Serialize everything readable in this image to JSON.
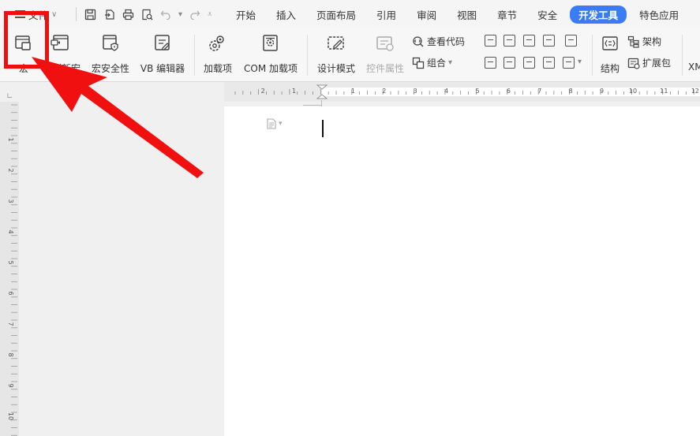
{
  "menu": {
    "file_label": "文件",
    "tabs": [
      "开始",
      "插入",
      "页面布局",
      "引用",
      "审阅",
      "视图",
      "章节",
      "安全",
      "开发工具",
      "特色应用"
    ],
    "active_tab": "开发工具"
  },
  "ribbon": {
    "macro": "宏",
    "record_macro": "录制新宏",
    "macro_security": "宏安全性",
    "vb_editor": "VB 编辑器",
    "addins": "加载项",
    "com_addins": "COM 加载项",
    "design_mode": "设计模式",
    "control_properties": "控件属性",
    "view_code": "查看代码",
    "group": "组合",
    "structure": "结构",
    "schema": "架构",
    "expansion_pack": "扩展包",
    "xml_partial": "XM"
  },
  "ruler": {
    "top_numbers": [
      "2",
      "1",
      "1",
      "2",
      "3",
      "4",
      "5",
      "6",
      "7",
      "8",
      "9",
      "10",
      "11",
      "12"
    ],
    "left_numbers": [
      "1",
      "2",
      "3",
      "4",
      "5",
      "6",
      "7",
      "8",
      "9",
      "10"
    ]
  },
  "colors": {
    "accent": "#3a7cf5",
    "highlight": "#f00f0f"
  }
}
